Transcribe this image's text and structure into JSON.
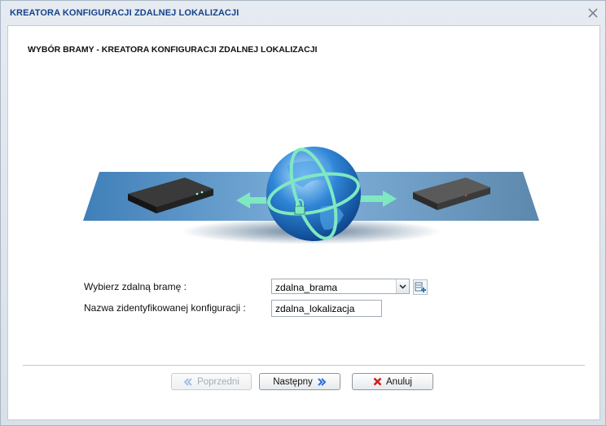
{
  "window": {
    "title": "KREATORA KONFIGURACJI ZDALNEJ LOKALIZACJI"
  },
  "page": {
    "heading": "WYBÓR BRAMY - KREATORA KONFIGURACJI ZDALNEJ LOKALIZACJI"
  },
  "form": {
    "gateway_label": "Wybierz zdalną bramę :",
    "gateway_value": "zdalna_brama",
    "config_name_label": "Nazwa zidentyfikowanej konfiguracji :",
    "config_name_value": "zdalna_lokalizacja"
  },
  "buttons": {
    "previous_label": "Poprzedni",
    "next_label": "Następny",
    "cancel_label": "Anuluj"
  },
  "colors": {
    "title_text": "#15428b",
    "arrow": "#7fe8c1",
    "cancel_icon": "#cc1f1f",
    "nav_icon": "#2a6fd8"
  }
}
